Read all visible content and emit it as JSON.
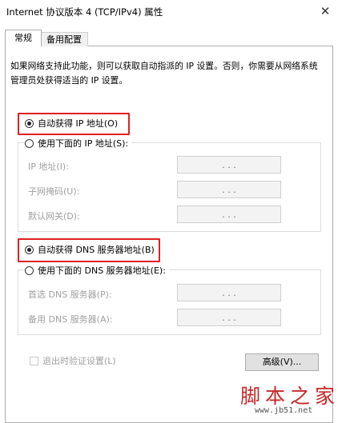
{
  "window": {
    "title": "Internet 协议版本 4 (TCP/IPv4) 属性",
    "close_glyph": "✕"
  },
  "tabs": [
    {
      "label": "常规",
      "selected": true
    },
    {
      "label": "备用配置",
      "selected": false
    }
  ],
  "description": "如果网络支持此功能，则可以获取自动指派的 IP 设置。否则，你需要从网络系统管理员处获得适当的 IP 设置。",
  "ip_section": {
    "auto_label": "自动获得 IP 地址(O)",
    "auto_selected": true,
    "manual_label": "使用下面的 IP 地址(S):",
    "manual_selected": false,
    "fields": [
      {
        "label": "IP 地址(I):",
        "value": ". . ."
      },
      {
        "label": "子网掩码(U):",
        "value": ". . ."
      },
      {
        "label": "默认网关(D):",
        "value": ". . ."
      }
    ]
  },
  "dns_section": {
    "auto_label": "自动获得 DNS 服务器地址(B)",
    "auto_selected": true,
    "manual_label": "使用下面的 DNS 服务器地址(E):",
    "manual_selected": false,
    "fields": [
      {
        "label": "首选 DNS 服务器(P):",
        "value": ". . ."
      },
      {
        "label": "备用 DNS 服务器(A):",
        "value": ". . ."
      }
    ]
  },
  "validate_on_exit": {
    "label": "退出时验证设置(L)",
    "checked": false
  },
  "advanced_button": "高级(V)...",
  "watermark": {
    "text": "脚本之家",
    "url": "www.jb51.net"
  },
  "colors": {
    "highlight_box": "#e02020",
    "watermark": "#c62828"
  }
}
